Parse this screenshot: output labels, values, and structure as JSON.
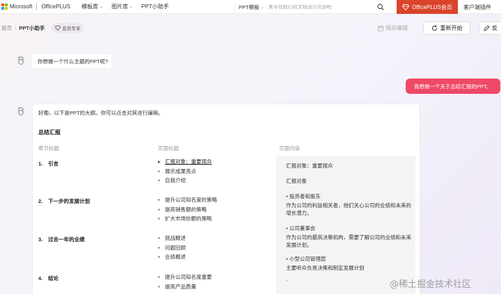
{
  "topbar": {
    "microsoft": "Microsoft",
    "brand": "OfficePLUS",
    "nav": [
      {
        "label": "模板库"
      },
      {
        "label": "图片库"
      },
      {
        "label": "PPT小助手"
      }
    ],
    "search_type": "PPT模板",
    "search_placeholder": "来寻找我们的文档设计灵感吧",
    "member_button": "OfficePLUS会员",
    "client_plugin": "客户端插件"
  },
  "subbar": {
    "home": "首页",
    "current": "PPT小助手",
    "vip_badge": "会员专享",
    "save_edit": "保存编辑",
    "restart": "重新开始",
    "feedback": "反"
  },
  "chat": {
    "bot_question": "你想做一个什么主题的PPT呢?",
    "user_message": "我想做一个关于总结汇报的PPT。",
    "intro": "好嘞，以下是PPT的大纲，你可以点击对其进行编辑。",
    "outline_title": "总结汇报",
    "columns": {
      "chapter": "章节标题",
      "page": "页面标题",
      "content": "页面内容"
    },
    "sections": [
      {
        "num": "1.",
        "title": "引言",
        "pages": [
          "汇报对象：重要观众",
          "展示成果亮点",
          "自我介绍"
        ]
      },
      {
        "num": "2.",
        "title": "下一步的发展计划",
        "pages": [
          "提升公司知名度的策略",
          "提高销售额的策略",
          "扩大市场份额的策略"
        ]
      },
      {
        "num": "3.",
        "title": "过去一年的业绩",
        "pages": [
          "挑战概述",
          "问题回顾",
          "业绩概述"
        ]
      },
      {
        "num": "4.",
        "title": "结论",
        "pages": [
          "提升公司知名度重要",
          "提高产品质量"
        ]
      }
    ],
    "content_panel": [
      "汇报对象：重要观众",
      "汇报对象",
      "• 投资者和股东",
      "作为公司的利益相关者，他们关心公司的业绩和未来的增长潜力。",
      "• 公司董事会",
      "作为公司的最高决策机构，需要了解公司的业绩和未来发展计划。",
      "• 小型公司管理层",
      "主要听众负责决策和制定发展计划",
      ","
    ]
  },
  "watermark": "@稀土掘金技术社区",
  "colors": {
    "accent": "#ee4966",
    "member": "#d9442b"
  }
}
